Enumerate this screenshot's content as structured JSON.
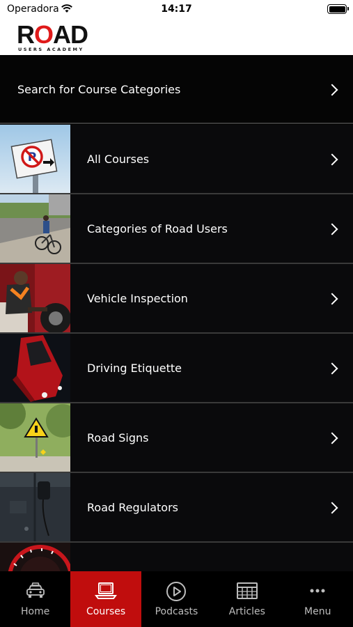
{
  "status_bar": {
    "carrier": "Operadora",
    "time": "14:17"
  },
  "header": {
    "logo_word_left": "R",
    "logo_word_o": "O",
    "logo_word_right": "AD",
    "logo_sub": "USERS   ACADEMY"
  },
  "search": {
    "label": "Search for Course Categories"
  },
  "categories": [
    {
      "label": "All Courses"
    },
    {
      "label": "Categories of Road Users"
    },
    {
      "label": "Vehicle Inspection"
    },
    {
      "label": "Driving Etiquette"
    },
    {
      "label": "Road Signs"
    },
    {
      "label": "Road Regulators"
    }
  ],
  "tabs": [
    {
      "label": "Home",
      "icon": "car-icon"
    },
    {
      "label": "Courses",
      "icon": "laptop-icon"
    },
    {
      "label": "Podcasts",
      "icon": "play-icon"
    },
    {
      "label": "Articles",
      "icon": "newspaper-icon"
    },
    {
      "label": "Menu",
      "icon": "more-icon"
    }
  ],
  "active_tab": "Courses",
  "colors": {
    "accent": "#c00d0d",
    "background": "#000000",
    "row": "#0a0a0c",
    "divider": "#3a3a3a"
  }
}
